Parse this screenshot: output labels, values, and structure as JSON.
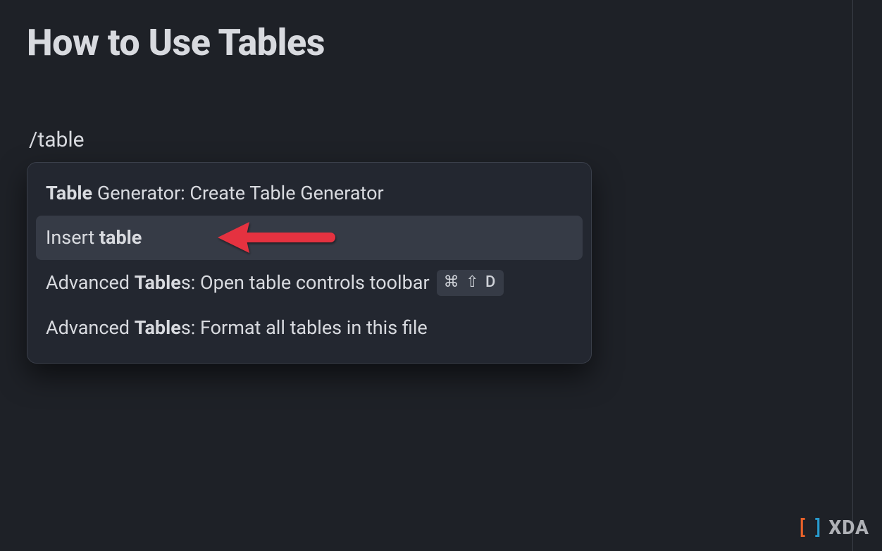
{
  "page": {
    "title": "How to Use Tables"
  },
  "slash_command": {
    "input": "/table"
  },
  "popup": {
    "items": [
      {
        "prefix_bold": "Table",
        "rest": " Generator: Create Table Generator",
        "selected": false,
        "shortcut": null
      },
      {
        "prefix": "Insert ",
        "bold": "table",
        "rest": "",
        "selected": true,
        "shortcut": null
      },
      {
        "prefix": "Advanced ",
        "bold": "Table",
        "rest": "s: Open table controls toolbar",
        "selected": false,
        "shortcut": "⌘ ⇧ D"
      },
      {
        "prefix": "Advanced ",
        "bold": "Table",
        "rest": "s: Format all tables in this file",
        "selected": false,
        "shortcut": null
      }
    ]
  },
  "annotation": {
    "arrow_color": "#e5323f"
  },
  "watermark": {
    "bracket_left": "[",
    "bracket_right": "]",
    "text": "XDA"
  }
}
